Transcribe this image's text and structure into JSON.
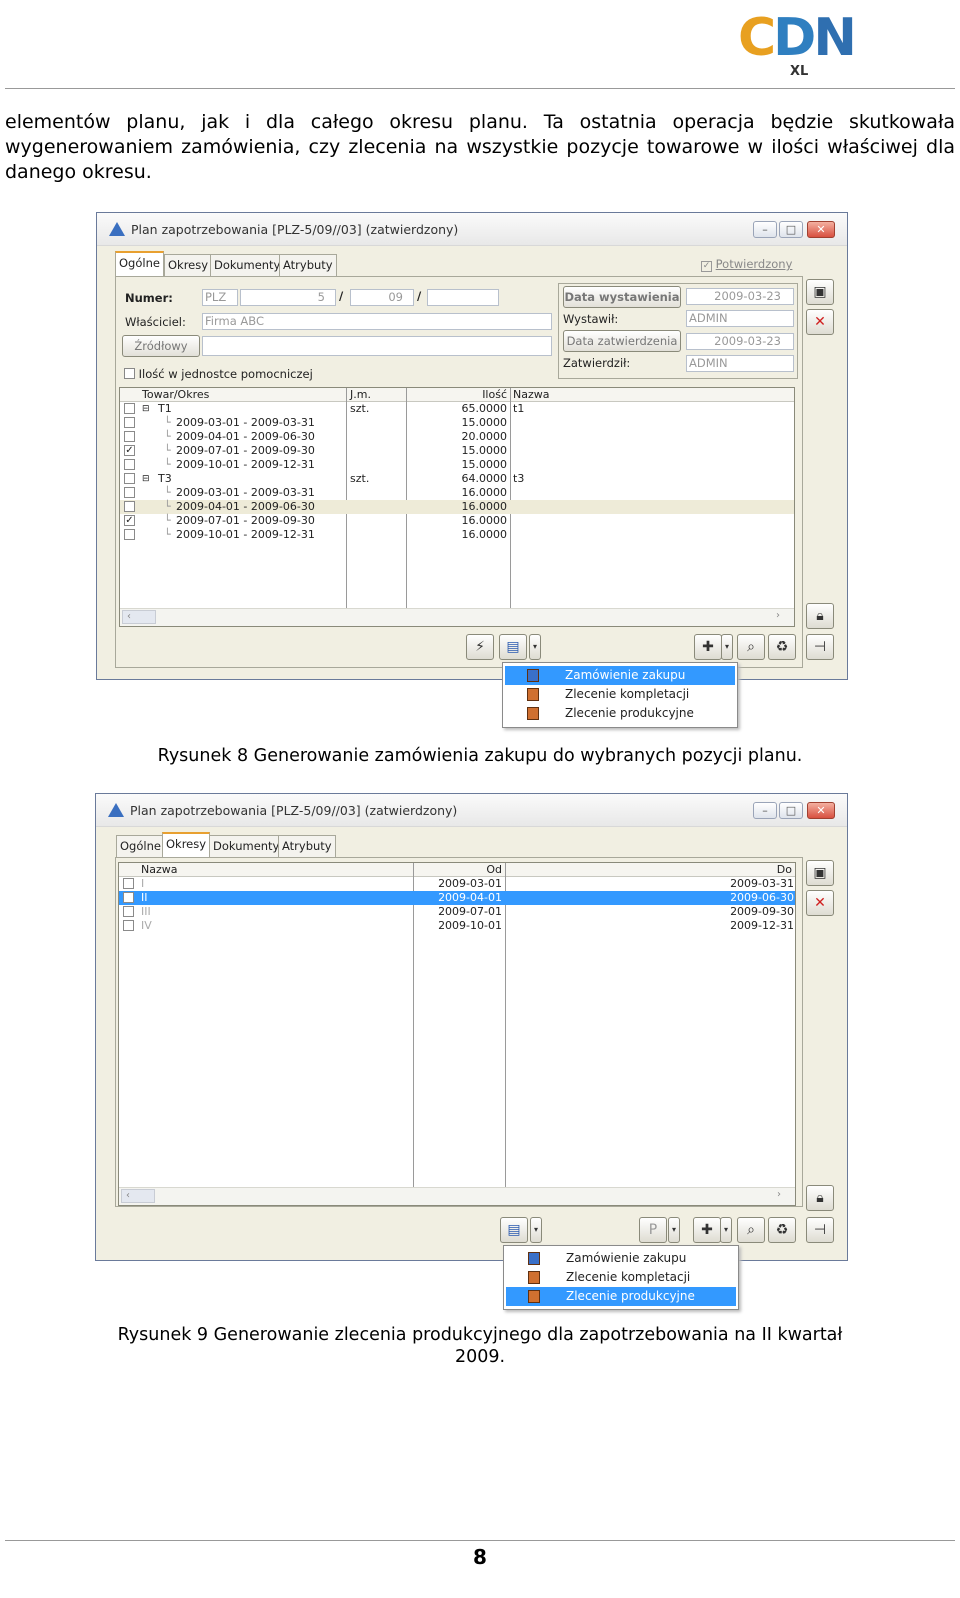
{
  "logo": {
    "c": "C",
    "d": "D",
    "n": "N",
    "sub": "XL"
  },
  "paragraph": {
    "line1": "elementów planu, jak i dla całego okresu planu. Ta ostatnia operacja będzie skutkowała",
    "line2": "wygenerowaniem zamówienia, czy zlecenia na wszystkie pozycje towarowe w ilości właściwej dla",
    "line3": "danego okresu."
  },
  "fig1": {
    "title": "Plan zapotrzebowania [PLZ-5/09//03] (zatwierdzony)",
    "tabs": [
      "Ogólne",
      "Okresy",
      "Dokumenty",
      "Atrybuty"
    ],
    "confirmed": "Potwierdzony",
    "numer_label": "Numer:",
    "numer_prefix": "PLZ",
    "numer_no": "5",
    "numer_month": "09",
    "owner_label": "Właściciel:",
    "owner_value": "Firma ABC",
    "source_btn": "Źródłowy",
    "issue_date_btn": "Data wystawienia",
    "issue_date": "2009-03-23",
    "issuer_label": "Wystawił:",
    "issuer": "ADMIN",
    "approve_date_btn": "Data zatwierdzenia",
    "approve_date": "2009-03-23",
    "approver_label": "Zatwierdził:",
    "approver": "ADMIN",
    "aux_unit": "Ilość w jednostce pomocniczej",
    "columns": [
      "Towar/Okres",
      "J.m.",
      "Ilość",
      "Nazwa"
    ],
    "rows": [
      {
        "check": "",
        "name": "T1",
        "unit": "szt.",
        "qty": "65.0000",
        "desc": "t1",
        "group": true
      },
      {
        "check": "",
        "name": "2009-03-01 - 2009-03-31",
        "unit": "",
        "qty": "15.0000",
        "desc": ""
      },
      {
        "check": "",
        "name": "2009-04-01 - 2009-06-30",
        "unit": "",
        "qty": "20.0000",
        "desc": ""
      },
      {
        "check": "✓",
        "name": "2009-07-01 - 2009-09-30",
        "unit": "",
        "qty": "15.0000",
        "desc": ""
      },
      {
        "check": "",
        "name": "2009-10-01 - 2009-12-31",
        "unit": "",
        "qty": "15.0000",
        "desc": ""
      },
      {
        "check": "",
        "name": "T3",
        "unit": "szt.",
        "qty": "64.0000",
        "desc": "t3",
        "group": true
      },
      {
        "check": "",
        "name": "2009-03-01 - 2009-03-31",
        "unit": "",
        "qty": "16.0000",
        "desc": ""
      },
      {
        "check": "",
        "name": "2009-04-01 - 2009-06-30",
        "unit": "",
        "qty": "16.0000",
        "desc": ""
      },
      {
        "check": "✓",
        "name": "2009-07-01 - 2009-09-30",
        "unit": "",
        "qty": "16.0000",
        "desc": ""
      },
      {
        "check": "",
        "name": "2009-10-01 - 2009-12-31",
        "unit": "",
        "qty": "16.0000",
        "desc": ""
      }
    ],
    "menu": [
      "Zamówienie zakupu",
      "Zlecenie kompletacji",
      "Zlecenie produkcyjne"
    ]
  },
  "caption1": "Rysunek 8 Generowanie zamówienia zakupu do wybranych pozycji planu.",
  "fig2": {
    "title": "Plan zapotrzebowania [PLZ-5/09//03] (zatwierdzony)",
    "tabs": [
      "Ogólne",
      "Okresy",
      "Dokumenty",
      "Atrybuty"
    ],
    "columns": [
      "Nazwa",
      "Od",
      "Do"
    ],
    "rows": [
      {
        "check": "",
        "name": "I",
        "from": "2009-03-01",
        "to": "2009-03-31"
      },
      {
        "check": "✓",
        "name": "II",
        "from": "2009-04-01",
        "to": "2009-06-30"
      },
      {
        "check": "",
        "name": "III",
        "from": "2009-07-01",
        "to": "2009-09-30"
      },
      {
        "check": "",
        "name": "IV",
        "from": "2009-10-01",
        "to": "2009-12-31"
      }
    ],
    "p_btn": "P",
    "menu": [
      "Zamówienie zakupu",
      "Zlecenie kompletacji",
      "Zlecenie produkcyjne"
    ]
  },
  "caption2_line1": "Rysunek 9 Generowanie zlecenia produkcyjnego dla zapotrzebowania na II kwartał",
  "caption2_line2": "2009.",
  "page_number": "8"
}
